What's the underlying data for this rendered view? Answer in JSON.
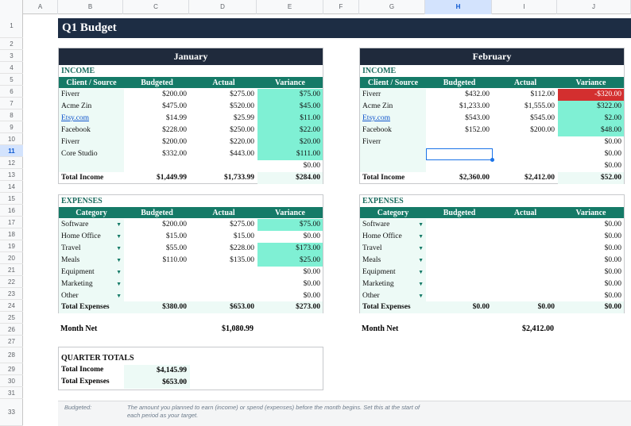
{
  "columns": [
    "A",
    "B",
    "C",
    "D",
    "E",
    "F",
    "G",
    "H",
    "I",
    "J"
  ],
  "rows": [
    "1",
    "2",
    "3",
    "4",
    "5",
    "6",
    "7",
    "8",
    "9",
    "10",
    "11",
    "12",
    "13",
    "14",
    "15",
    "16",
    "17",
    "18",
    "19",
    "20",
    "21",
    "22",
    "23",
    "24",
    "25",
    "26",
    "27",
    "28",
    "29",
    "30",
    "31",
    "33"
  ],
  "title": "Q1 Budget",
  "headers": {
    "income_section": "INCOME",
    "expenses_section": "EXPENSES",
    "client_source": "Client / Source",
    "category": "Category",
    "budgeted": "Budgeted",
    "actual": "Actual",
    "variance": "Variance",
    "total_income": "Total Income",
    "total_expenses": "Total Expenses",
    "month_net": "Month Net"
  },
  "january": {
    "month": "January",
    "income": [
      {
        "source": "Fiverr",
        "budgeted": "$200.00",
        "actual": "$275.00",
        "variance": "$75.00"
      },
      {
        "source": "Acme Zin",
        "budgeted": "$475.00",
        "actual": "$520.00",
        "variance": "$45.00"
      },
      {
        "source": "Etsy.com",
        "budgeted": "$14.99",
        "actual": "$25.99",
        "variance": "$11.00"
      },
      {
        "source": "Facebook",
        "budgeted": "$228.00",
        "actual": "$250.00",
        "variance": "$22.00"
      },
      {
        "source": "Fiverr",
        "budgeted": "$200.00",
        "actual": "$220.00",
        "variance": "$20.00"
      },
      {
        "source": "Core Studio",
        "budgeted": "$332.00",
        "actual": "$443.00",
        "variance": "$111.00"
      },
      {
        "source": "",
        "budgeted": "",
        "actual": "",
        "variance": "$0.00"
      }
    ],
    "income_total": {
      "budgeted": "$1,449.99",
      "actual": "$1,733.99",
      "variance": "$284.00"
    },
    "expenses": [
      {
        "category": "Software",
        "budgeted": "$200.00",
        "actual": "$275.00",
        "variance": "$75.00"
      },
      {
        "category": "Home Office",
        "budgeted": "$15.00",
        "actual": "$15.00",
        "variance": "$0.00"
      },
      {
        "category": "Travel",
        "budgeted": "$55.00",
        "actual": "$228.00",
        "variance": "$173.00"
      },
      {
        "category": "Meals",
        "budgeted": "$110.00",
        "actual": "$135.00",
        "variance": "$25.00"
      },
      {
        "category": "Equipment",
        "budgeted": "",
        "actual": "",
        "variance": "$0.00"
      },
      {
        "category": "Marketing",
        "budgeted": "",
        "actual": "",
        "variance": "$0.00"
      },
      {
        "category": "Other",
        "budgeted": "",
        "actual": "",
        "variance": "$0.00"
      }
    ],
    "expenses_total": {
      "budgeted": "$380.00",
      "actual": "$653.00",
      "variance": "$273.00"
    },
    "month_net": "$1,080.99"
  },
  "february": {
    "month": "February",
    "income": [
      {
        "source": "Fiverr",
        "budgeted": "$432.00",
        "actual": "$112.00",
        "variance": "-$320.00"
      },
      {
        "source": "Acme Zin",
        "budgeted": "$1,233.00",
        "actual": "$1,555.00",
        "variance": "$322.00"
      },
      {
        "source": "Etsy.com",
        "budgeted": "$543.00",
        "actual": "$545.00",
        "variance": "$2.00"
      },
      {
        "source": "Facebook",
        "budgeted": "$152.00",
        "actual": "$200.00",
        "variance": "$48.00"
      },
      {
        "source": "Fiverr",
        "budgeted": "",
        "actual": "",
        "variance": "$0.00"
      },
      {
        "source": "",
        "budgeted": "",
        "actual": "",
        "variance": "$0.00"
      },
      {
        "source": "",
        "budgeted": "",
        "actual": "",
        "variance": "$0.00"
      }
    ],
    "income_total": {
      "budgeted": "$2,360.00",
      "actual": "$2,412.00",
      "variance": "$52.00"
    },
    "expenses": [
      {
        "category": "Software",
        "budgeted": "",
        "actual": "",
        "variance": "$0.00"
      },
      {
        "category": "Home Office",
        "budgeted": "",
        "actual": "",
        "variance": "$0.00"
      },
      {
        "category": "Travel",
        "budgeted": "",
        "actual": "",
        "variance": "$0.00"
      },
      {
        "category": "Meals",
        "budgeted": "",
        "actual": "",
        "variance": "$0.00"
      },
      {
        "category": "Equipment",
        "budgeted": "",
        "actual": "",
        "variance": "$0.00"
      },
      {
        "category": "Marketing",
        "budgeted": "",
        "actual": "",
        "variance": "$0.00"
      },
      {
        "category": "Other",
        "budgeted": "",
        "actual": "",
        "variance": "$0.00"
      }
    ],
    "expenses_total": {
      "budgeted": "$0.00",
      "actual": "$0.00",
      "variance": "$0.00"
    },
    "month_net": "$2,412.00"
  },
  "quarter": {
    "title": "QUARTER TOTALS",
    "total_income_label": "Total Income",
    "total_income": "$4,145.99",
    "total_expenses_label": "Total Expenses",
    "total_expenses": "$653.00"
  },
  "footer": {
    "term": "Budgeted:",
    "definition": "The amount you planned to earn (income) or spend (expenses) before the month begins. Set this at the start of each period as your target."
  },
  "colors": {
    "title_bg": "#1d2d44",
    "header_teal": "#157a67",
    "positive": "#7ff0d4",
    "negative": "#d32f2f",
    "label_bg": "#edfaf6"
  }
}
